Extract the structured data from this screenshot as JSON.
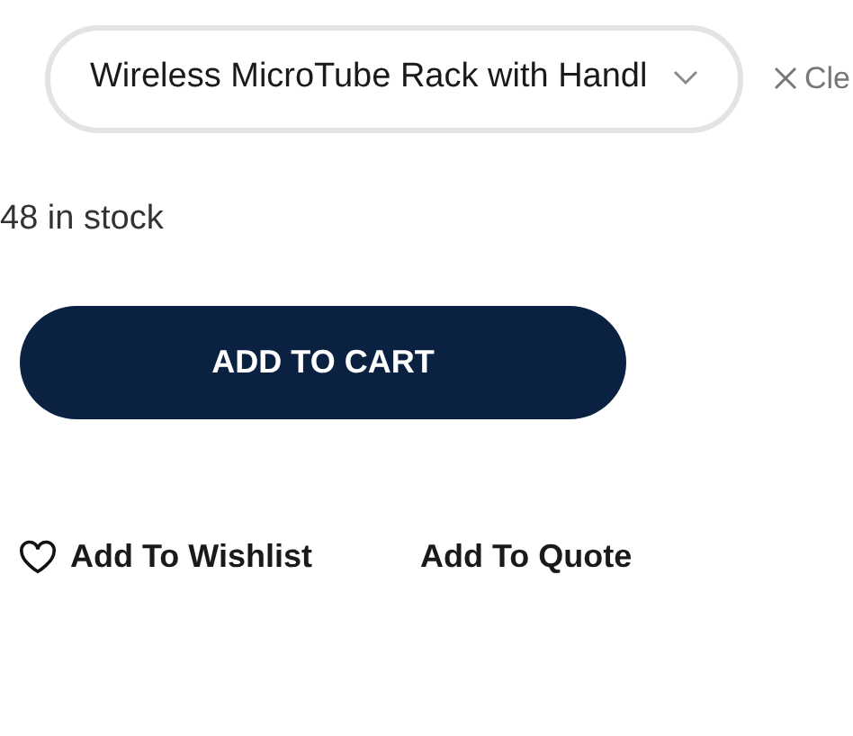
{
  "variant_select": {
    "value": "Wireless MicroTube Rack with Handl"
  },
  "clear": {
    "label": "Cle"
  },
  "stock": "48 in stock",
  "add_to_cart": {
    "label": "ADD TO CART"
  },
  "actions": [
    {
      "kind": "wishlist",
      "label": "Add To Wishlist"
    },
    {
      "kind": "quote",
      "label": "Add To Quote"
    }
  ]
}
